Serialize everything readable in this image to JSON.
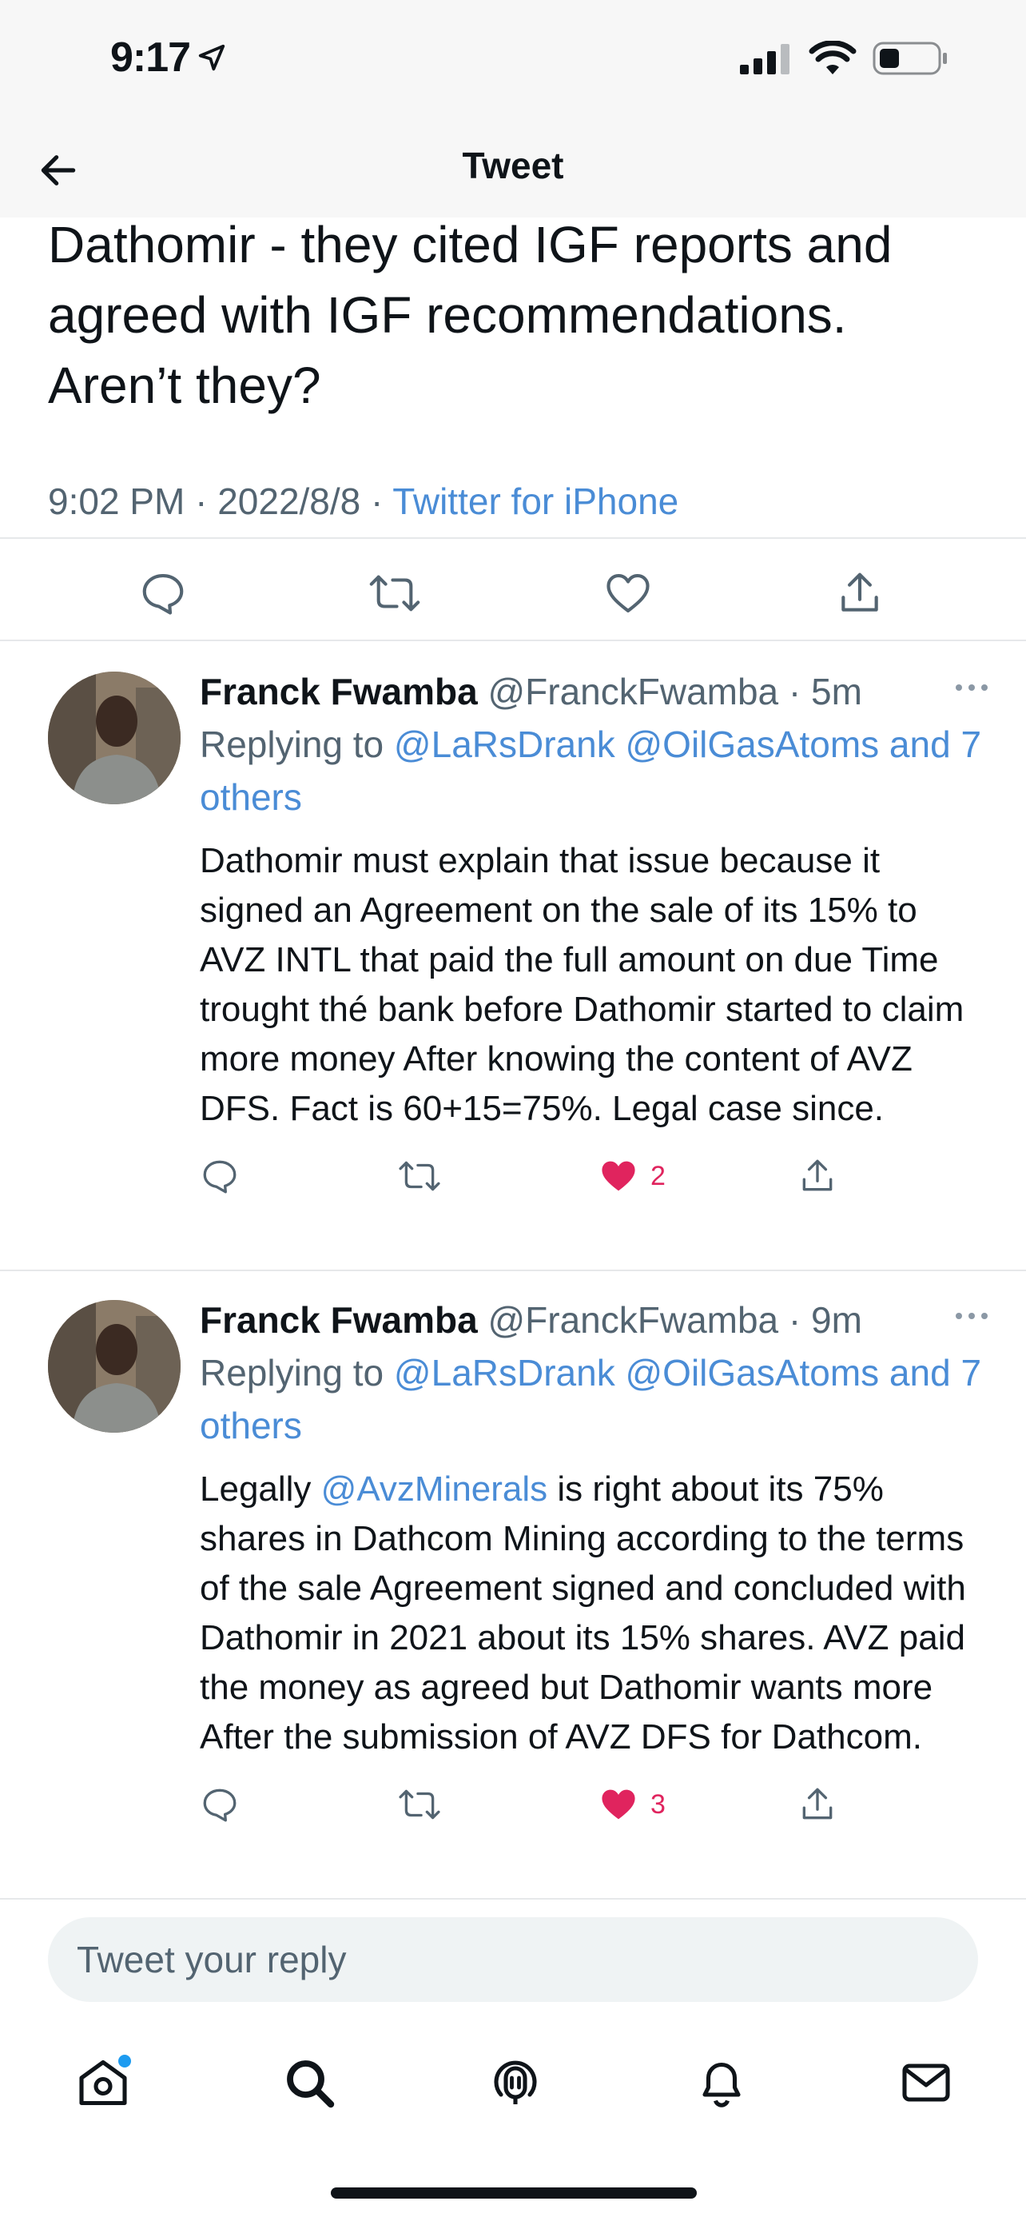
{
  "status_bar": {
    "time": "9:17"
  },
  "nav": {
    "title": "Tweet"
  },
  "tweet": {
    "text": "Dathomir - they cited IGF reports and agreed with IGF recommendations. Aren’t they?",
    "time": "9:02 PM · 2022/8/8 · ",
    "source": "Twitter for iPhone"
  },
  "replies": [
    {
      "name": "Franck Fwamba",
      "handle": "@FranckFwamba",
      "age": "· 5m",
      "replying_prefix": "Replying to ",
      "replying_to": "@LaRsDrank @OilGasAtoms and 7 others",
      "text_before": "",
      "mention": "",
      "text": "Dathomir must explain that issue because it signed an Agreement on the sale of its 15% to AVZ INTL that paid the full amount on due Time trought thé bank before Dathomir started to claim more money After knowing the content of AVZ DFS. Fact is 60+15=75%. Legal case since.",
      "likes": "2"
    },
    {
      "name": "Franck Fwamba",
      "handle": "@FranckFwamba",
      "age": "· 9m",
      "replying_prefix": "Replying to ",
      "replying_to": "@LaRsDrank @OilGasAtoms and 7 others",
      "text_before": "Legally ",
      "mention": "@AvzMinerals",
      "text": " is right about its 75% shares in Dathcom Mining according to the terms of the sale Agreement signed and concluded with Dathomir in 2021 about its 15% shares. AVZ paid the money as agreed but Dathomir wants more After the submission of AVZ DFS for Dathcom.",
      "likes": "3"
    }
  ],
  "reply_box": {
    "placeholder": "Tweet your reply"
  },
  "colors": {
    "link": "#4a8cd6",
    "like": "#e0245e",
    "icon": "#536471"
  },
  "icons": [
    "location-arrow-icon",
    "signal-icon",
    "wifi-icon",
    "battery-icon",
    "back-arrow-icon",
    "reply-icon",
    "retweet-icon",
    "heart-icon",
    "share-icon",
    "more-icon",
    "home-icon",
    "search-icon",
    "spaces-icon",
    "notifications-icon",
    "messages-icon"
  ]
}
